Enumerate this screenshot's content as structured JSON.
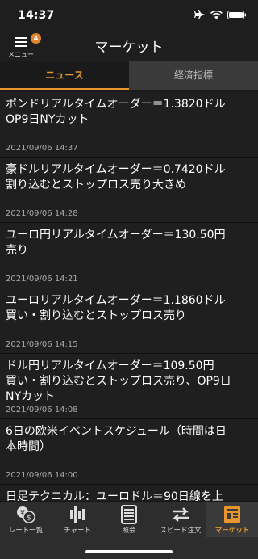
{
  "status": {
    "time": "14:37"
  },
  "header": {
    "title": "マーケット",
    "menu_label": "メニュー",
    "menu_badge": "4"
  },
  "tabs": [
    {
      "label": "ニュース",
      "active": true
    },
    {
      "label": "経済指標",
      "active": false
    }
  ],
  "news": [
    {
      "title": "ポンドリアルタイムオーダー＝1.3820ドル\nOP9日NYカット",
      "date": "2021/09/06 14:37"
    },
    {
      "title": "豪ドルリアルタイムオーダー＝0.7420ドル\n割り込むとストップロス売り大きめ",
      "date": "2021/09/06 14:28"
    },
    {
      "title": "ユーロ円リアルタイムオーダー＝130.50円\n売り",
      "date": "2021/09/06 14:21"
    },
    {
      "title": "ユーロリアルタイムオーダー＝1.1860ドル\n買い・割り込むとストップロス売り",
      "date": "2021/09/06 14:15"
    },
    {
      "title": "ドル円リアルタイムオーダー＝109.50円\n買い・割り込むとストップロス売り、OP9日\nNYカット",
      "date": "2021/09/06 14:08"
    },
    {
      "title": "6日の欧米イベントスケジュール（時間は日\n本時間）",
      "date": "2021/09/06 14:00"
    },
    {
      "title": "日足テクニカル：ユーロドル＝90日線を上",
      "date": ""
    }
  ],
  "tabbar": [
    {
      "label": "レート一覧",
      "icon": "rate-list-icon",
      "active": false
    },
    {
      "label": "チャート",
      "icon": "chart-icon",
      "active": false
    },
    {
      "label": "照会",
      "icon": "inquiry-icon",
      "active": false
    },
    {
      "label": "スピード注文",
      "icon": "speed-order-icon",
      "active": false
    },
    {
      "label": "マーケット",
      "icon": "market-icon",
      "active": true
    }
  ],
  "colors": {
    "accent": "#e8962f",
    "background": "#1b1b1b"
  }
}
